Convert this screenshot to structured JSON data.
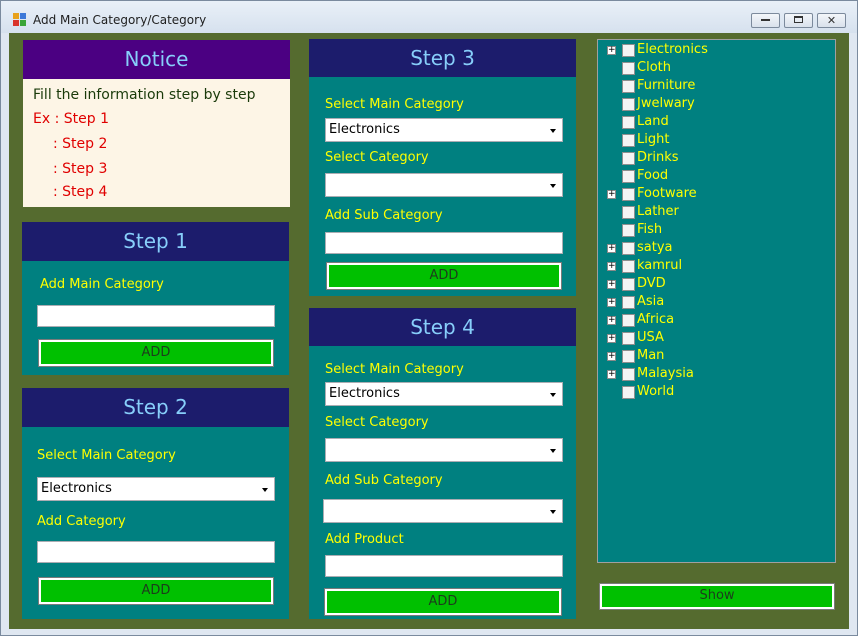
{
  "window": {
    "title": "Add Main Category/Category"
  },
  "notice": {
    "title": "Notice",
    "line1": "Fill the information step by step",
    "line2": "Ex : Step 1",
    "line3": ": Step 2",
    "line4": ": Step 3",
    "line5": ": Step 4"
  },
  "step1": {
    "title": "Step 1",
    "label_main": "Add Main Category",
    "main_value": "",
    "button": "ADD"
  },
  "step2": {
    "title": "Step 2",
    "label_select_main": "Select Main Category",
    "select_main_value": "Electronics",
    "label_add_category": "Add Category",
    "category_value": "",
    "button": "ADD"
  },
  "step3": {
    "title": "Step 3",
    "label_select_main": "Select Main Category",
    "select_main_value": "Electronics",
    "label_select_category": "Select Category",
    "select_category_value": "",
    "label_add_sub": "Add Sub Category",
    "sub_value": "",
    "button": "ADD"
  },
  "step4": {
    "title": "Step 4",
    "label_select_main": "Select Main Category",
    "select_main_value": "Electronics",
    "label_select_category": "Select Category",
    "select_category_value": "",
    "label_add_sub": "Add Sub Category",
    "select_sub_value": "",
    "label_add_product": "Add Product",
    "product_value": "",
    "button": "ADD"
  },
  "tree": {
    "nodes": [
      {
        "label": "Electronics",
        "expandable": true
      },
      {
        "label": "Cloth",
        "expandable": false
      },
      {
        "label": "Furniture",
        "expandable": false
      },
      {
        "label": "Jwelwary",
        "expandable": false
      },
      {
        "label": "Land",
        "expandable": false
      },
      {
        "label": "Light",
        "expandable": false
      },
      {
        "label": "Drinks",
        "expandable": false
      },
      {
        "label": "Food",
        "expandable": false
      },
      {
        "label": "Footware",
        "expandable": true
      },
      {
        "label": "Lather",
        "expandable": false
      },
      {
        "label": "Fish",
        "expandable": false
      },
      {
        "label": "satya",
        "expandable": true
      },
      {
        "label": "kamrul",
        "expandable": true
      },
      {
        "label": "DVD",
        "expandable": true
      },
      {
        "label": "Asia",
        "expandable": true
      },
      {
        "label": "Africa",
        "expandable": true
      },
      {
        "label": "USA",
        "expandable": true
      },
      {
        "label": "Man",
        "expandable": true
      },
      {
        "label": "Malaysia",
        "expandable": true
      },
      {
        "label": "World",
        "expandable": false
      }
    ]
  },
  "show_button": "Show",
  "colors": {
    "form_background": "#556b2f",
    "panel": "#008080",
    "panel_header": "#1c1c6c",
    "header_text": "#87cefa",
    "label_text": "#ffff00",
    "button": "#00c000",
    "notice_bg": "#fdf5e6",
    "notice_header": "#4b0082"
  }
}
